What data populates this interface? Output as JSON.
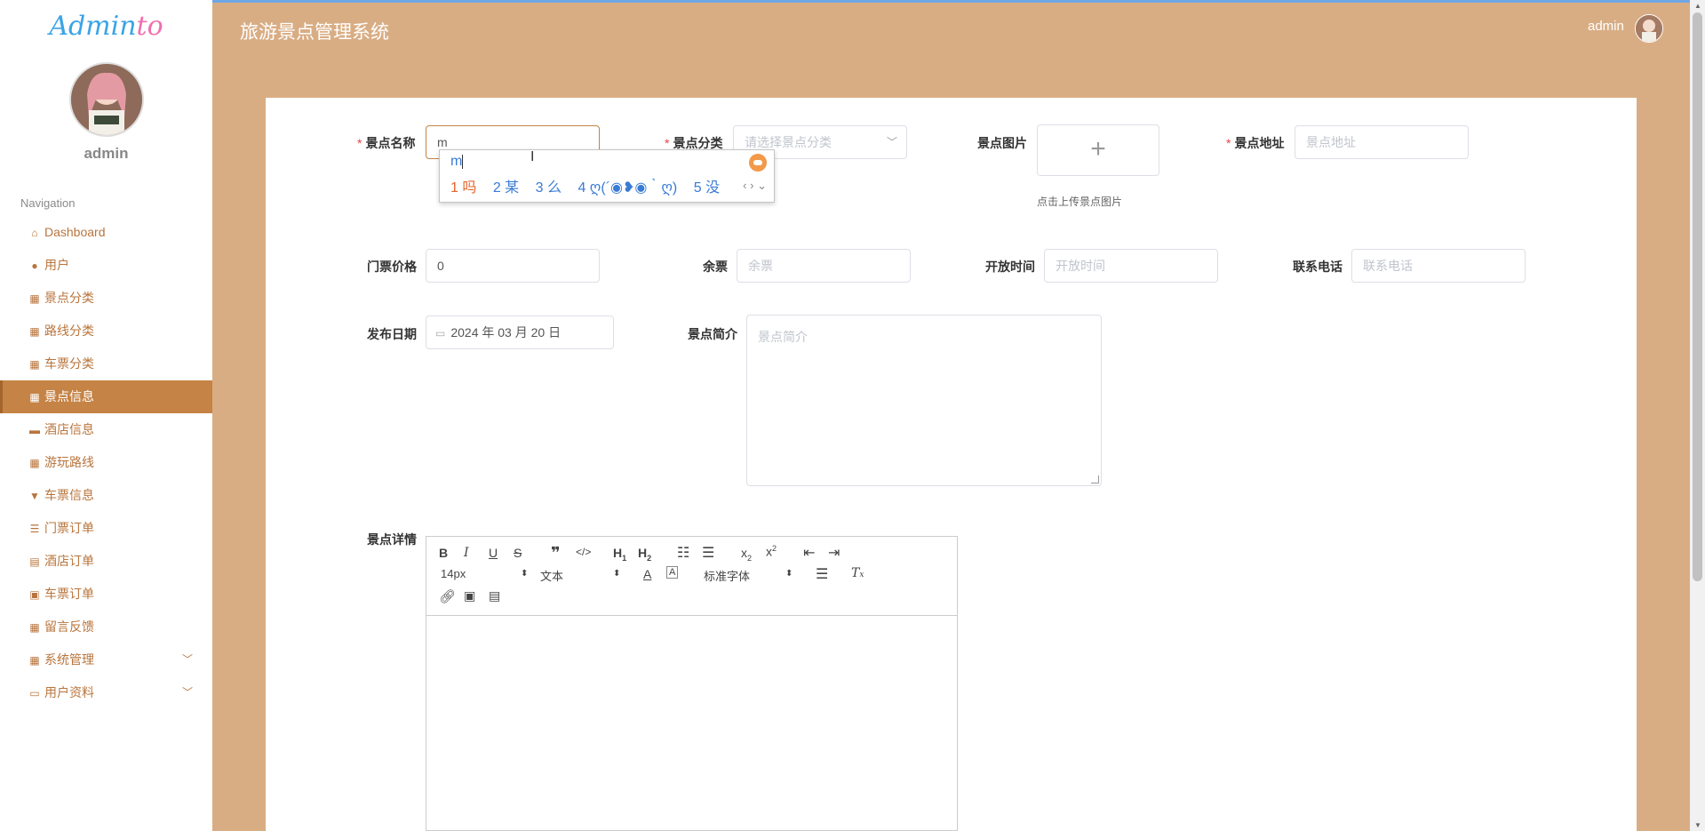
{
  "brand": {
    "logo_main": "Admin",
    "logo_end": "to"
  },
  "sidebar": {
    "username": "admin",
    "nav_title": "Navigation",
    "items": [
      {
        "label": "Dashboard",
        "icon": "home-icon"
      },
      {
        "label": "用户",
        "icon": "user-icon"
      },
      {
        "label": "景点分类",
        "icon": "grid-icon"
      },
      {
        "label": "路线分类",
        "icon": "grid-icon"
      },
      {
        "label": "车票分类",
        "icon": "grid-icon"
      },
      {
        "label": "景点信息",
        "icon": "grid-icon",
        "active": true
      },
      {
        "label": "酒店信息",
        "icon": "briefcase-icon"
      },
      {
        "label": "游玩路线",
        "icon": "grid-icon"
      },
      {
        "label": "车票信息",
        "icon": "sign-icon"
      },
      {
        "label": "门票订单",
        "icon": "list-icon"
      },
      {
        "label": "酒店订单",
        "icon": "clipboard-icon"
      },
      {
        "label": "车票订单",
        "icon": "clipboard-check-icon"
      },
      {
        "label": "留言反馈",
        "icon": "grid-icon"
      },
      {
        "label": "系统管理",
        "icon": "grid-icon",
        "expandable": true
      },
      {
        "label": "用户资料",
        "icon": "calendar-icon",
        "expandable": true
      }
    ]
  },
  "header": {
    "title": "旅游景点管理系统",
    "username": "admin"
  },
  "form": {
    "name": {
      "label": "景点名称",
      "value": "m"
    },
    "category": {
      "label": "景点分类",
      "placeholder": "请选择景点分类"
    },
    "image": {
      "label": "景点图片",
      "hint": "点击上传景点图片"
    },
    "address": {
      "label": "景点地址",
      "placeholder": "景点地址"
    },
    "price": {
      "label": "门票价格",
      "value": "0"
    },
    "remaining": {
      "label": "余票",
      "placeholder": "余票"
    },
    "open_time": {
      "label": "开放时间",
      "placeholder": "开放时间"
    },
    "phone": {
      "label": "联系电话",
      "placeholder": "联系电话"
    },
    "publish_date": {
      "label": "发布日期",
      "value": "2024 年 03 月 20 日"
    },
    "intro": {
      "label": "景点简介",
      "placeholder": "景点简介"
    },
    "detail": {
      "label": "景点详情"
    }
  },
  "editor": {
    "font_size": "14px",
    "text_type": "文本",
    "font_family": "标准字体"
  },
  "ime": {
    "composition": "m",
    "candidates": [
      "1 吗",
      "2 某",
      "3 么",
      "4 ღ(´◉❥◉｀ღ)",
      "5 没"
    ]
  },
  "colors": {
    "accent": "#c58346",
    "header_bg": "#d9ad84",
    "required": "#e64242"
  }
}
